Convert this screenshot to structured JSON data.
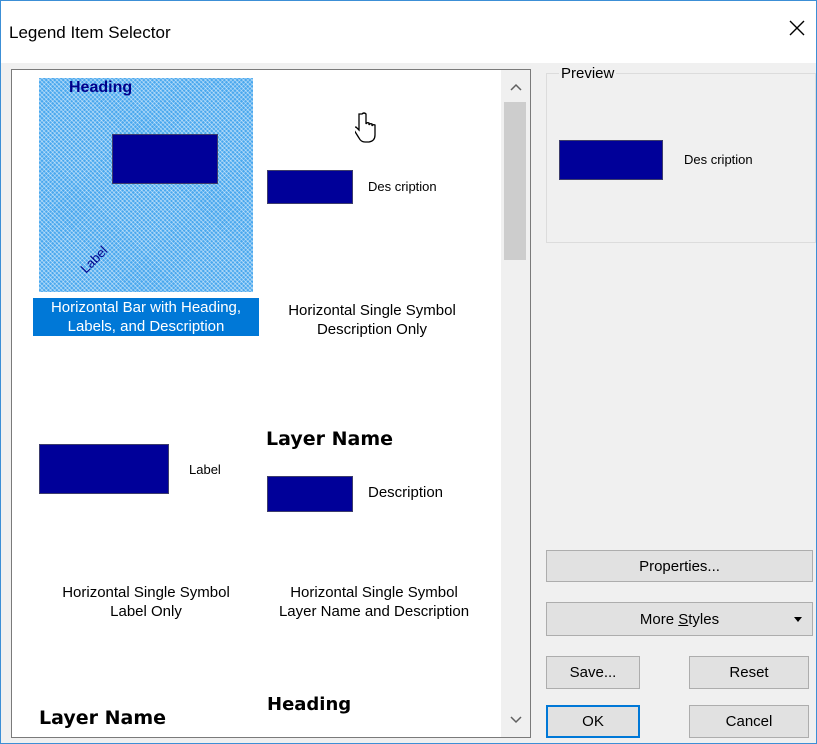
{
  "window": {
    "title": "Legend Item Selector"
  },
  "colors": {
    "accent": "#0078d7",
    "symbol": "#000099",
    "heading_blue": "#00008b"
  },
  "icons": {
    "close": "close-icon",
    "scroll_up": "chevron-up-icon",
    "scroll_down": "chevron-down-icon",
    "cursor": "hand-pointer-icon",
    "dropdown": "dropdown-arrow-icon"
  },
  "styles": [
    {
      "caption_line1": "Horizontal Bar with Heading,",
      "caption_line2": "Labels, and Description",
      "sample_heading": "Heading",
      "sample_label": "Label",
      "selected": true
    },
    {
      "caption_line1": "Horizontal Single Symbol",
      "caption_line2": "Description Only",
      "sample_description": "Des cription"
    },
    {
      "caption_line1": "Horizontal Single Symbol",
      "caption_line2": "Label Only",
      "sample_label": "Label"
    },
    {
      "caption_line1": "Horizontal Single Symbol",
      "caption_line2": "Layer Name and Description",
      "sample_layer_name": "Layer Name",
      "sample_description": "Description"
    },
    {
      "sample_layer_name": "Layer Name"
    },
    {
      "sample_heading": "Heading"
    }
  ],
  "preview": {
    "label": "Preview",
    "description": "Des cription"
  },
  "buttons": {
    "properties": "Properties...",
    "more_styles_prefix": "More ",
    "more_styles_mnemonic": "S",
    "more_styles_suffix": "tyles",
    "save": "Save...",
    "reset": "Reset",
    "ok": "OK",
    "cancel": "Cancel"
  }
}
